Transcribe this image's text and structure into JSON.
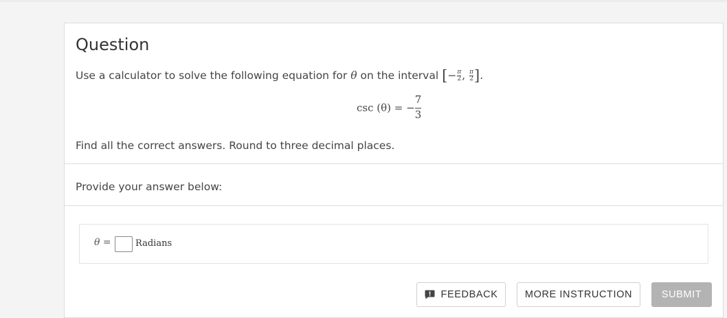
{
  "question": {
    "heading": "Question",
    "prompt_before": "Use a calculator to solve the following equation for",
    "theta_symbol": "θ",
    "prompt_after": "on the interval",
    "interval": {
      "open_bracket": "[",
      "minus": "−",
      "num1": "π",
      "den1": "2",
      "separator": ",",
      "num2": "π",
      "den2": "2",
      "close_bracket": "]",
      "period": "."
    },
    "equation": {
      "lhs": "csc (θ) =",
      "sign": "−",
      "numerator": "7",
      "denominator": "3"
    },
    "instruction": "Find all the correct answers. Round to three decimal places."
  },
  "answer_section": {
    "label": "Provide your answer below:",
    "variable_label": "θ =",
    "input_value": "",
    "units": "Radians"
  },
  "buttons": {
    "feedback": "FEEDBACK",
    "more_instruction": "MORE INSTRUCTION",
    "submit": "SUBMIT"
  },
  "icons": {
    "feedback": "feedback-speech-bubble-icon"
  },
  "colors": {
    "submit_bg": "#b3b3b3",
    "page_bg": "#f4f4f4",
    "card_bg": "#ffffff"
  }
}
